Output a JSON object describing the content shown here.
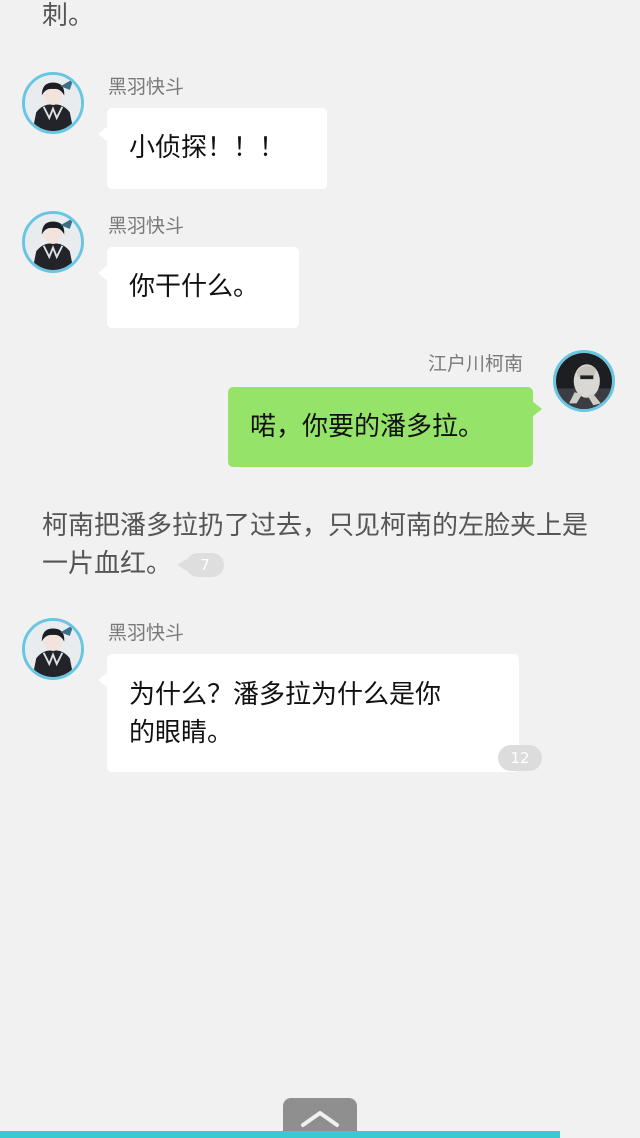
{
  "narration_top": "刺。",
  "messages": [
    {
      "sender": "黑羽快斗",
      "text": "小侦探！！！"
    },
    {
      "sender": "黑羽快斗",
      "text": "你干什么。"
    },
    {
      "sender": "江户川柯南",
      "text": "喏，你要的潘多拉。"
    },
    {
      "sender": "黑羽快斗",
      "text_line1": "为什么？潘多拉为什么是你",
      "text_line2": "的眼睛。",
      "comment_count": "12"
    }
  ],
  "narration_mid": {
    "text": "柯南把潘多拉扔了过去，只见柯南的左脸夹上是一片血红。",
    "comment_count": "7"
  },
  "progress": {
    "value": 0.875,
    "color": "#38c9d3"
  },
  "icons": {
    "scroll_top": "chevron-up-icon",
    "avatar_kaito": "character-avatar-icon",
    "avatar_conan": "character-avatar-icon"
  },
  "colors": {
    "background": "#f1f1f1",
    "incoming_bubble": "#ffffff",
    "outgoing_bubble": "#96e36a",
    "avatar_ring": "#68c6e3"
  }
}
